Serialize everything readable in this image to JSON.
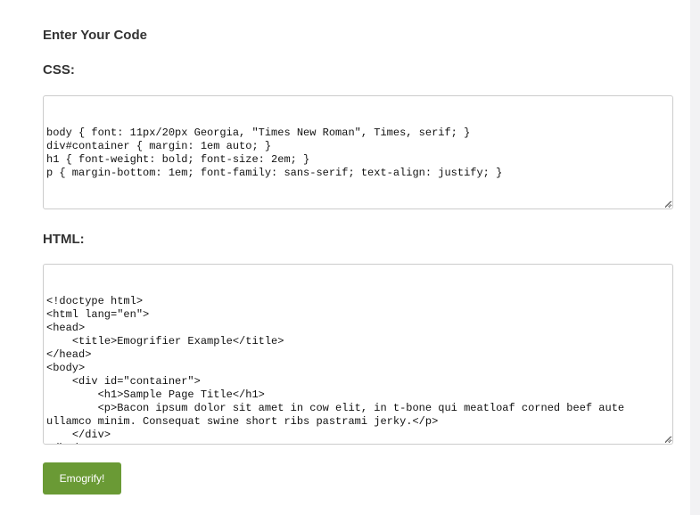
{
  "page": {
    "title": "Enter Your Code",
    "css_heading": "CSS:",
    "html_heading": "HTML:"
  },
  "css_input": {
    "value": "body { font: 11px/20px Georgia, \"Times New Roman\", Times, serif; }\ndiv#container { margin: 1em auto; }\nh1 { font-weight: bold; font-size: 2em; }\np { margin-bottom: 1em; font-family: sans-serif; text-align: justify; }"
  },
  "html_input": {
    "value": "<!doctype html>\n<html lang=\"en\">\n<head>\n    <title>Emogrifier Example</title>\n</head>\n<body>\n    <div id=\"container\">\n        <h1>Sample Page Title</h1>\n        <p>Bacon ipsum dolor sit amet in cow elit, in t-bone qui meatloaf corned beef aute ullamco minim. Consequat swine short ribs pastrami jerky.</p>\n    </div>\n</body>\n</html>"
  },
  "actions": {
    "submit_label": "Emogrify!"
  },
  "colors": {
    "button": "#6a9a35",
    "text": "#333333",
    "border": "#cccccc"
  }
}
